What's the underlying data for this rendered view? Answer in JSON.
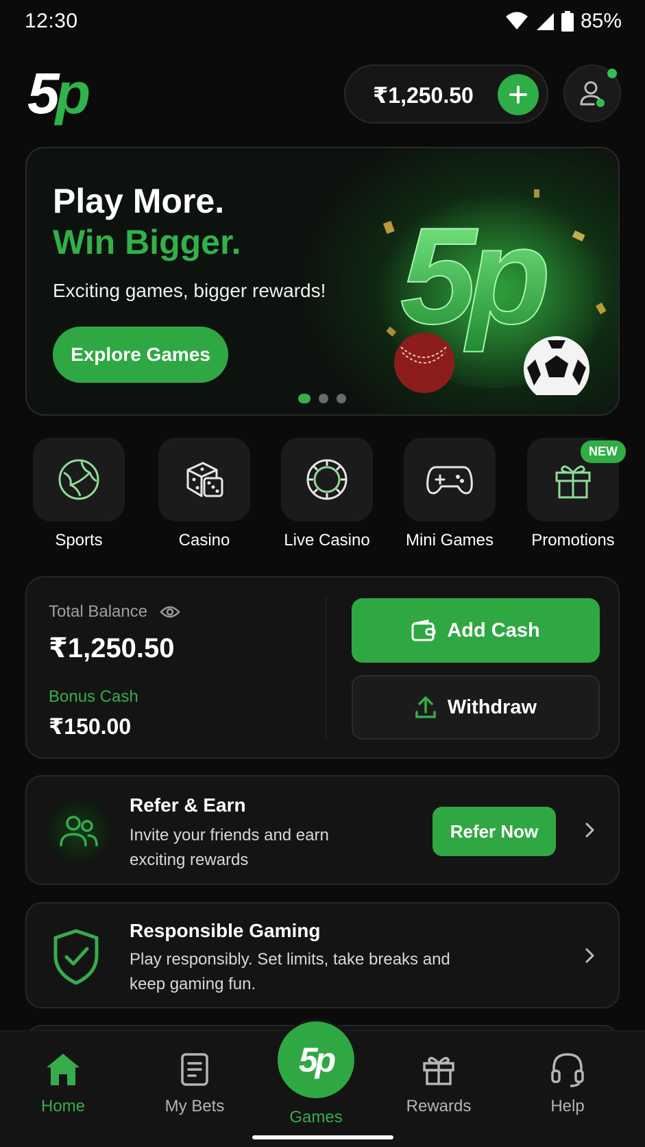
{
  "status_bar": {
    "time": "12:30",
    "battery": "85%"
  },
  "header": {
    "logo_five": "5",
    "logo_p": "p",
    "balance": "₹1,250.50"
  },
  "hero": {
    "title_line1": "Play More.",
    "title_line2": "Win Bigger.",
    "subtitle": "Exciting games, bigger rewards!",
    "cta": "Explore Games",
    "art_logo": "5p",
    "active_slide": 1,
    "slide_count": 3
  },
  "categories": [
    {
      "label": "Sports",
      "icon": "globe-ball-icon"
    },
    {
      "label": "Casino",
      "icon": "dice-icon"
    },
    {
      "label": "Live Casino",
      "icon": "poker-chip-icon"
    },
    {
      "label": "Mini Games",
      "icon": "gamepad-icon"
    },
    {
      "label": "Promotions",
      "icon": "gift-icon",
      "badge": "NEW"
    }
  ],
  "balance_card": {
    "total_label": "Total Balance",
    "total_amount": "₹1,250.50",
    "bonus_label": "Bonus Cash",
    "bonus_amount": "₹150.00",
    "add_cash": "Add Cash",
    "withdraw": "Withdraw"
  },
  "refer": {
    "title": "Refer & Earn",
    "desc": "Invite your friends and earn exciting rewards",
    "cta": "Refer Now"
  },
  "responsible": {
    "title": "Responsible Gaming",
    "desc": "Play responsibly. Set limits, take breaks and keep gaming fun."
  },
  "bottom_nav": {
    "home": "Home",
    "my_bets": "My Bets",
    "games_logo": "5p",
    "games": "Games",
    "rewards": "Rewards",
    "help": "Help"
  },
  "colors": {
    "accent": "#2fa843",
    "background": "#0b0b0b",
    "card": "#141414"
  }
}
